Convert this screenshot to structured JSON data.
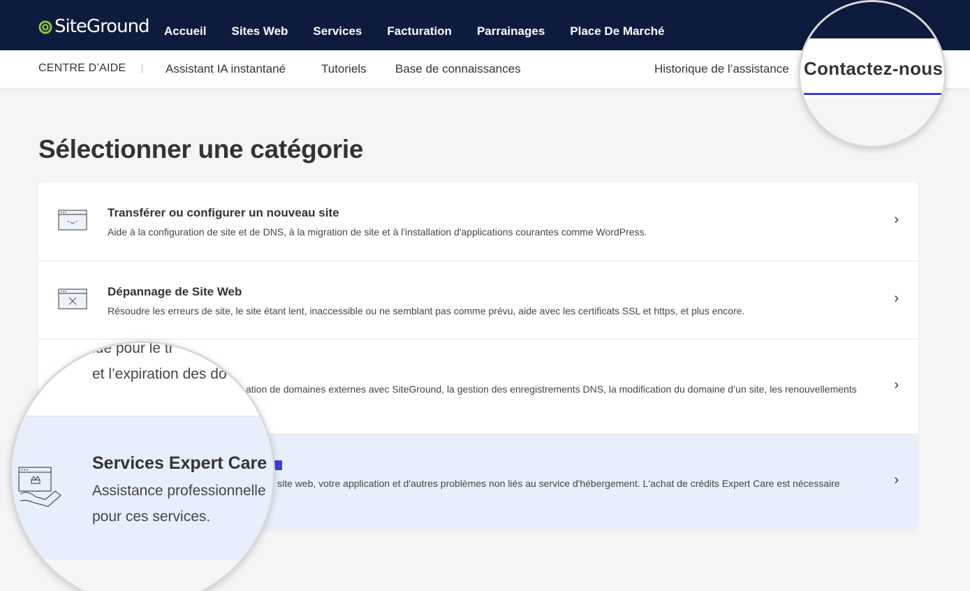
{
  "brand": {
    "name": "SiteGround",
    "accent": "#3b3fd8",
    "nav_bg": "#0d1b3e",
    "logo_green": "#8dc63f"
  },
  "main_nav": [
    "Accueil",
    "Sites Web",
    "Services",
    "Facturation",
    "Parrainages",
    "Place De Marché"
  ],
  "sub_nav": {
    "help_center": "CENTRE D’AIDE",
    "links": [
      "Assistant IA instantané",
      "Tutoriels",
      "Base de connaissances"
    ],
    "history": "Historique de l’assistance",
    "contact": "Contactez-nous"
  },
  "page_title": "Sélectionner une catégorie",
  "categories": [
    {
      "title": "Transférer ou configurer un nouveau site",
      "description": "Aide à la configuration de site et de DNS, à la migration de site et à l'installation d'applications courantes comme WordPress.",
      "icon": "browser-smile-icon"
    },
    {
      "title": "Dépannage de Site Web",
      "description": "Résoudre les erreurs de site, le site étant lent, inaccessible ou ne semblant pas comme prévu, aide avec les certificats SSL et https, et plus encore.",
      "icon": "browser-error-icon"
    },
    {
      "description_visible": "ation de domaines externes avec SiteGround, la gestion des enregistrements DNS, la modification du domaine d’un site, les renouvellements",
      "icon": "domain-icon"
    },
    {
      "title": "Services Expert Care",
      "description_visible": "site web, votre application et d'autres problèmes non liés au service d'hébergement. L'achat de crédits Expert Care est nécessaire",
      "icon": "expert-care-icon"
    }
  ],
  "magnifier_top": {
    "text": "Contactez-nous"
  },
  "magnifier_bottom": {
    "line1": "ide pour le tr",
    "line2": "et l’expiration des do",
    "title": "Services Expert Care",
    "desc1": "Assistance professionnelle",
    "desc2": "pour ces services."
  }
}
